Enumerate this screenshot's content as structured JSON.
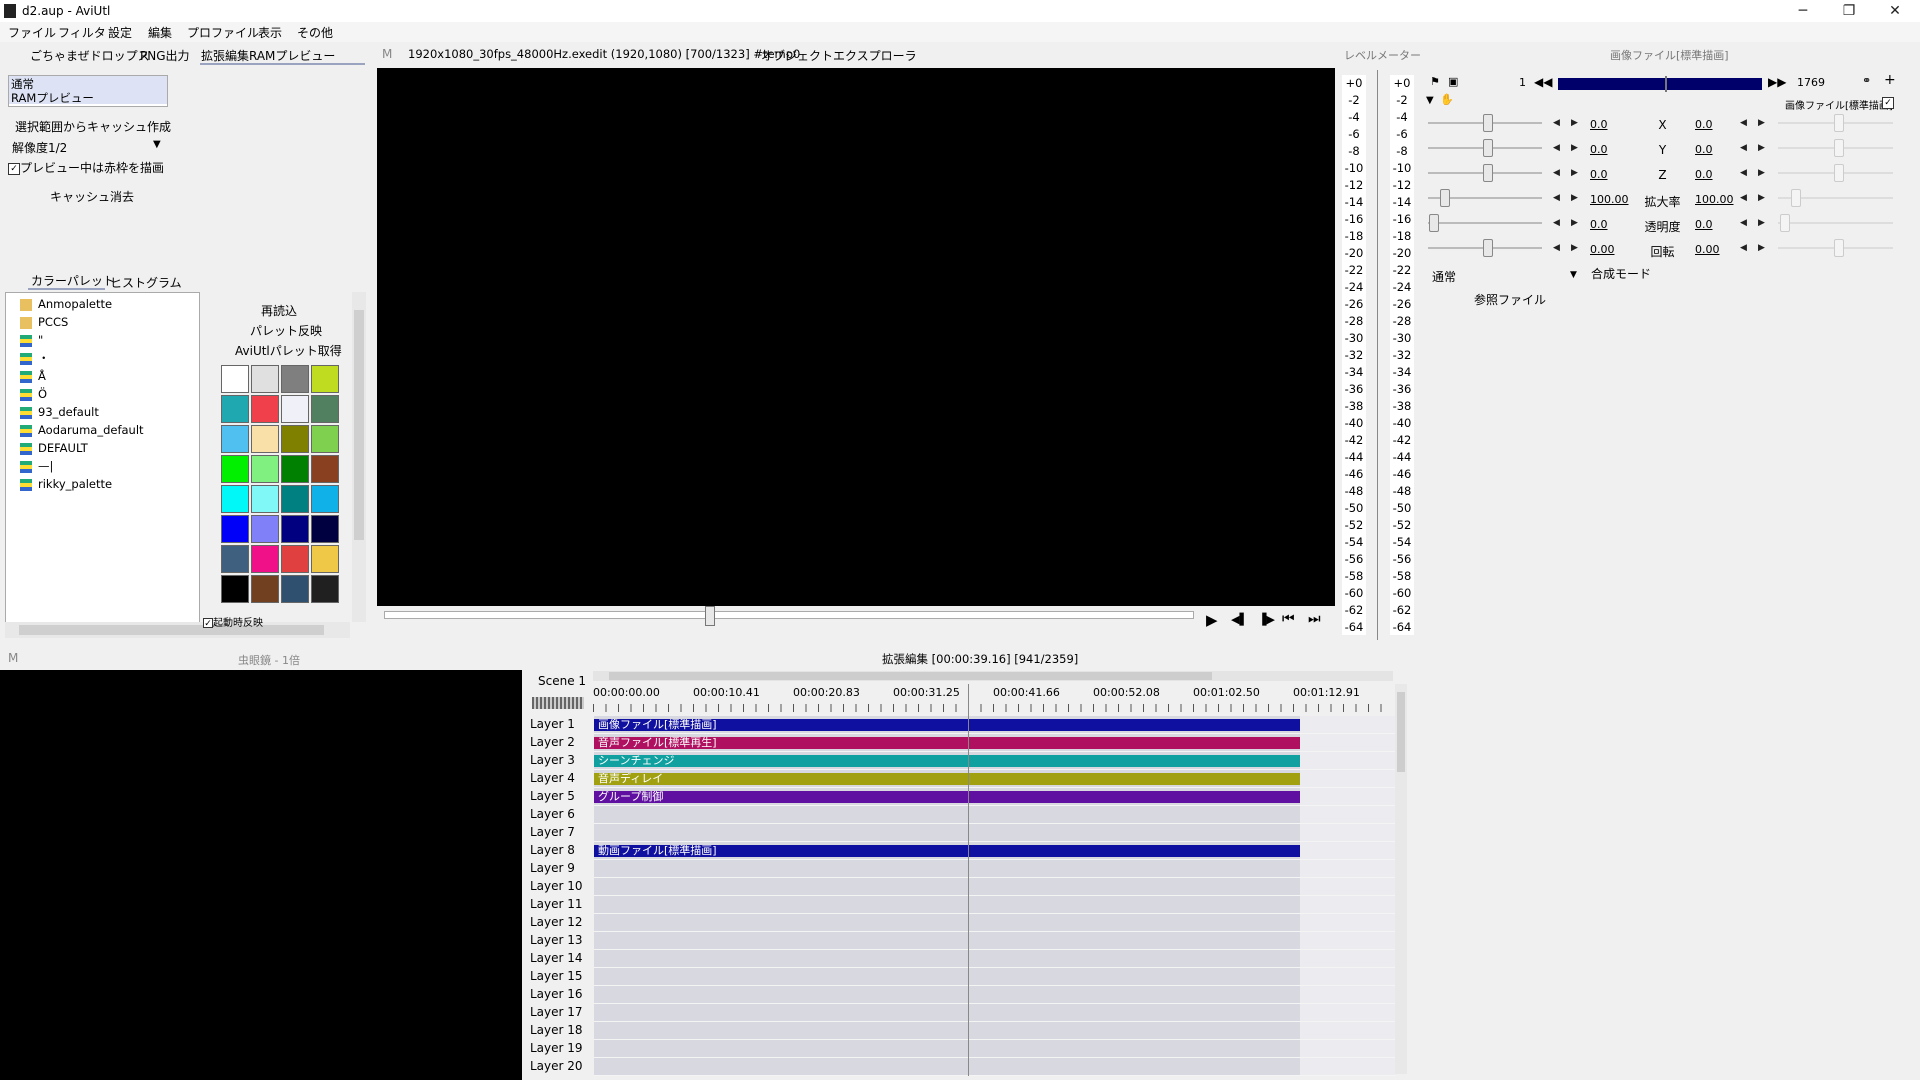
{
  "window": {
    "title": "d2.aup - AviUtl",
    "controls": [
      "─",
      "❐",
      "✕"
    ]
  },
  "menu": [
    "ファイル",
    "フィルタ",
    "設定",
    "編集",
    "プロファイル",
    "表示",
    "その他"
  ],
  "left_tabs": [
    "ごちゃまぜドロップス",
    "PNG出力",
    "拡張編集RAMプレビュー"
  ],
  "preview_mode": {
    "options": [
      "通常",
      "RAMプレビュー"
    ]
  },
  "cache": {
    "create": "選択範囲からキャッシュ作成",
    "resolution": "解像度1/2",
    "red_frame_label": "プレビュー中は赤枠を描画",
    "red_frame_checked": true,
    "clear": "キャッシュ消去"
  },
  "palette_tabs": [
    "カラーパレット",
    "ヒストグラム"
  ],
  "palette_tree": [
    "Anmopalette",
    "PCCS",
    "\"",
    "・",
    "Å",
    "Ö",
    "93_default",
    "Aodaruma_default",
    "DEFAULT",
    "—|",
    "rikky_palette"
  ],
  "palette_buttons": [
    "再読込",
    "パレット反映",
    "AviUtlパレット取得"
  ],
  "palette_bottom_check": "起動時反映",
  "palette_colors": [
    "#ffffff",
    "#e0e0e0",
    "#7f7f7f",
    "#c0dc20",
    "#20a8b0",
    "#f0404c",
    "#f0f0f8",
    "#508060",
    "#50c0f0",
    "#f8e0a8",
    "#808000",
    "#80d050",
    "#00f000",
    "#80f080",
    "#008000",
    "#884020",
    "#00f8f8",
    "#80f8f8",
    "#008080",
    "#10b0e8",
    "#0000f8",
    "#8080f8",
    "#000080",
    "#000040",
    "#406080",
    "#f01088",
    "#e04040",
    "#f0c848",
    "#000000",
    "#704020",
    "#305070",
    "#202020"
  ],
  "preview_header": {
    "m": "M",
    "info": "1920x1080_30fps_48000Hz.exedit (1920,1080)  [700/1323]  #temp0",
    "explorer": "オブジェクトエクスプローラ"
  },
  "level_meter": {
    "title": "レベルメーター",
    "ticks": [
      "+0",
      "-2",
      "-4",
      "-6",
      "-8",
      "-10",
      "-12",
      "-14",
      "-16",
      "-18",
      "-20",
      "-22",
      "-24",
      "-26",
      "-28",
      "-30",
      "-32",
      "-34",
      "-36",
      "-38",
      "-40",
      "-42",
      "-44",
      "-46",
      "-48",
      "-50",
      "-52",
      "-54",
      "-56",
      "-58",
      "-60",
      "-62",
      "-64"
    ]
  },
  "seek": {
    "position": 0.4
  },
  "playback_buttons": [
    "▶",
    "◀▌",
    "▐▶",
    "⏮",
    "⏭"
  ],
  "object_settings": {
    "title": "画像ファイル[標準描画]",
    "start_frame": "1",
    "end_frame": "1769",
    "filter_name": "画像ファイル[標準描画]",
    "params": [
      {
        "left": "0.0",
        "name": "X",
        "right": "0.0"
      },
      {
        "left": "0.0",
        "name": "Y",
        "right": "0.0"
      },
      {
        "left": "0.0",
        "name": "Z",
        "right": "0.0"
      },
      {
        "left": "100.00",
        "name": "拡大率",
        "right": "100.00"
      },
      {
        "left": "0.0",
        "name": "透明度",
        "right": "0.0"
      },
      {
        "left": "0.00",
        "name": "回転",
        "right": "0.00"
      }
    ],
    "blend_value": "通常",
    "blend_label": "合成モード",
    "ref_file": "参照ファイル"
  },
  "magnifier": {
    "m": "M",
    "label": "虫眼鏡 - 1倍"
  },
  "timeline": {
    "title": "拡張編集 [00:00:39.16] [941/2359]",
    "scene": "Scene 1",
    "times": [
      "00:00:00.00",
      "00:00:10.41",
      "00:00:20.83",
      "00:00:31.25",
      "00:00:41.66",
      "00:00:52.08",
      "00:01:02.50",
      "00:01:12.91"
    ],
    "layers": [
      "Layer 1",
      "Layer 2",
      "Layer 3",
      "Layer 4",
      "Layer 5",
      "Layer 6",
      "Layer 7",
      "Layer 8",
      "Layer 9",
      "Layer 10",
      "Layer 11",
      "Layer 12",
      "Layer 13",
      "Layer 14",
      "Layer 15",
      "Layer 16",
      "Layer 17",
      "Layer 18",
      "Layer 19",
      "Layer 20"
    ],
    "objects": [
      {
        "layer": 1,
        "label": "画像ファイル[標準描画]",
        "color": "#1010a0"
      },
      {
        "layer": 2,
        "label": "音声ファイル[標準再生]",
        "color": "#b01060"
      },
      {
        "layer": 3,
        "label": "シーンチェンジ",
        "color": "#10a0a0"
      },
      {
        "layer": 4,
        "label": "音声ディレイ",
        "color": "#a0a010"
      },
      {
        "layer": 5,
        "label": "グループ制御",
        "color": "#6010a0"
      },
      {
        "layer": 8,
        "label": "動画ファイル[標準描画]",
        "color": "#1010a0"
      }
    ]
  }
}
